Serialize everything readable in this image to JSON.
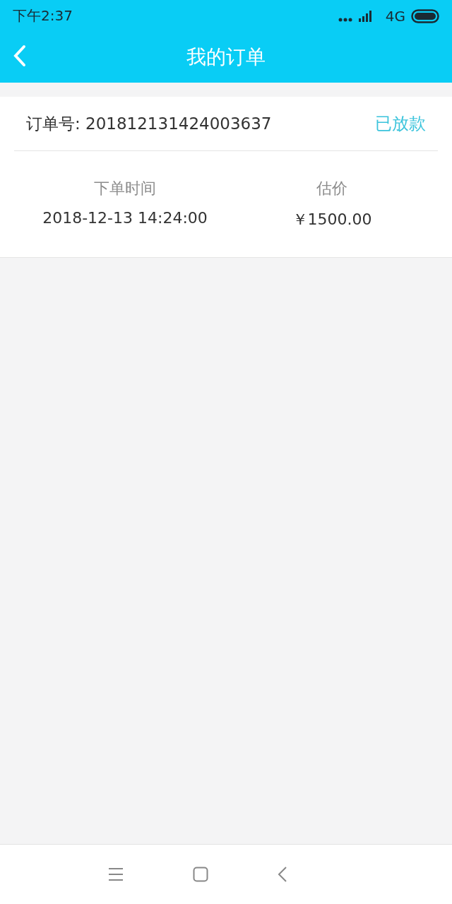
{
  "status_bar": {
    "time": "下午2:37",
    "network": "4G"
  },
  "header": {
    "title": "我的订单"
  },
  "order": {
    "number": "订单号: 201812131424003637",
    "status": "已放款",
    "details": [
      {
        "label": "下单时间",
        "value": "2018-12-13 14:24:00"
      },
      {
        "label": "估价",
        "value": "￥1500.00"
      }
    ]
  }
}
